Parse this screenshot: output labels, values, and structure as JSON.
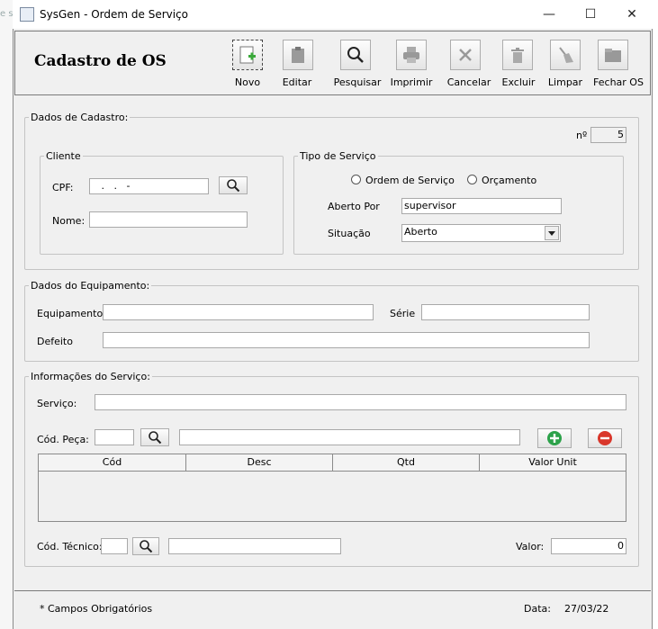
{
  "window": {
    "title": "SysGen - Ordem de Serviço",
    "bg_text": "e s",
    "min_glyph": "—",
    "max_glyph": "☐",
    "close_glyph": "✕"
  },
  "header": {
    "title": "Cadastro de OS"
  },
  "toolbar": {
    "novo": "Novo",
    "editar": "Editar",
    "pesquisar": "Pesquisar",
    "imprimir": "Imprimir",
    "cancelar": "Cancelar",
    "excluir": "Excluir",
    "limpar": "Limpar",
    "fechar": "Fechar OS"
  },
  "cadastro": {
    "legend": "Dados de Cadastro:",
    "num_label": "nº",
    "num_value": "5"
  },
  "cliente": {
    "legend": "Cliente",
    "cpf_label": "CPF:",
    "cpf_value": "   .   .   -",
    "nome_label": "Nome:",
    "nome_value": ""
  },
  "tipo": {
    "legend": "Tipo de Serviço",
    "radio_os": "Ordem de Serviço",
    "radio_orc": "Orçamento",
    "aberto_label": "Aberto Por",
    "aberto_value": "supervisor",
    "situacao_label": "Situação",
    "situacao_value": "Aberto"
  },
  "equipamento": {
    "legend": "Dados do Equipamento:",
    "equip_label": "Equipamento",
    "serie_label": "Série",
    "defeito_label": "Defeito"
  },
  "servico": {
    "legend": "Informações do Serviço:",
    "servico_label": "Serviço:",
    "peca_label": "Cód. Peça:",
    "columns": [
      "Cód",
      "Desc",
      "Qtd",
      "Valor Unit"
    ],
    "tecnico_label": "Cód. Técnico:",
    "valor_label": "Valor:",
    "valor_value": "0"
  },
  "status": {
    "obrigatorios": "* Campos Obrigatórios",
    "data_label": "Data:",
    "data_value": "27/03/22"
  },
  "colors": {
    "add": "#2ca24a",
    "remove": "#d9372b"
  }
}
